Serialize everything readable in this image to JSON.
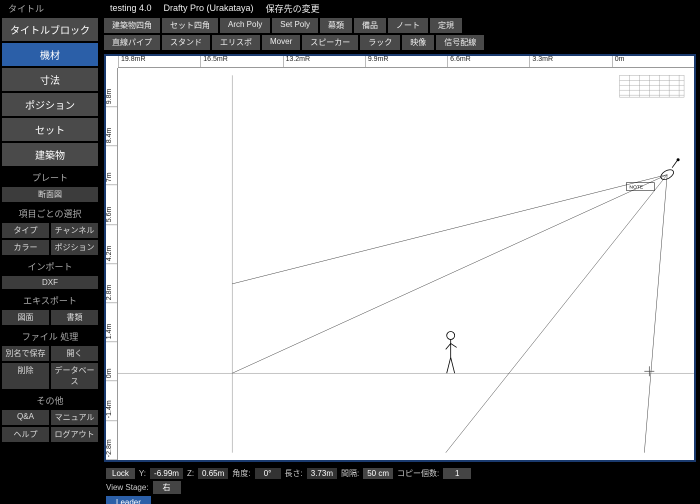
{
  "top": {
    "title_label": "タイトル",
    "doc": "testing 4.0",
    "app": "Drafty Pro (Urakataya)",
    "save": "保存先の変更"
  },
  "sidebar": {
    "main": [
      "タイトルブロック",
      "機材",
      "寸法",
      "ポジション",
      "セット",
      "建築物"
    ],
    "active_index": 1,
    "plate_header": "プレート",
    "plate_btn": "断面図",
    "select_header": "項目ごとの選択",
    "select_rows": [
      [
        "タイプ",
        "チャンネル"
      ],
      [
        "カラー",
        "ポジション"
      ]
    ],
    "import_header": "インポート",
    "import_btn": "DXF",
    "export_header": "エキスポート",
    "export_row": [
      "図面",
      "書類"
    ],
    "file_header": "ファイル 処理",
    "file_rows": [
      [
        "別名で保存",
        "開く"
      ],
      [
        "削除",
        "データベース"
      ]
    ],
    "other_header": "その他",
    "other_rows": [
      [
        "Q&A",
        "マニュアル"
      ],
      [
        "ヘルプ",
        "ログアウト"
      ]
    ]
  },
  "toolbar": {
    "row1": [
      "建築物四角",
      "セット四角",
      "Arch Poly",
      "Set Poly",
      "幕類",
      "備品",
      "ノート",
      "定規"
    ],
    "row2": [
      "直線パイプ",
      "スタンド",
      "エリスポ",
      "Mover",
      "スピーカー",
      "ラック",
      "映像",
      "信号配線"
    ]
  },
  "ruler": {
    "h": [
      "19.8mR",
      "16.5mR",
      "13.2mR",
      "9.9mR",
      "6.6mR",
      "3.3mR",
      "0m"
    ],
    "v": [
      "9.8m",
      "8.4m",
      "7m",
      "5.6m",
      "4.2m",
      "2.8m",
      "1.4m",
      "0m",
      "-1.4m",
      "-2.8m"
    ]
  },
  "canvas": {
    "note_label": "NOTE"
  },
  "status": {
    "lock": "Lock",
    "y_lbl": "Y:",
    "y_val": "-6.99m",
    "z_lbl": "Z:",
    "z_val": "0.65m",
    "angle_lbl": "角度:",
    "angle_val": "0°",
    "len_lbl": "長さ:",
    "len_val": "3.73m",
    "int_lbl": "間隔:",
    "int_val": "50 cm",
    "copy_lbl": "コピー個数:",
    "copy_val": "1",
    "viewstage_lbl": "View Stage:",
    "viewstage_val": "右",
    "leader": "Leader"
  }
}
